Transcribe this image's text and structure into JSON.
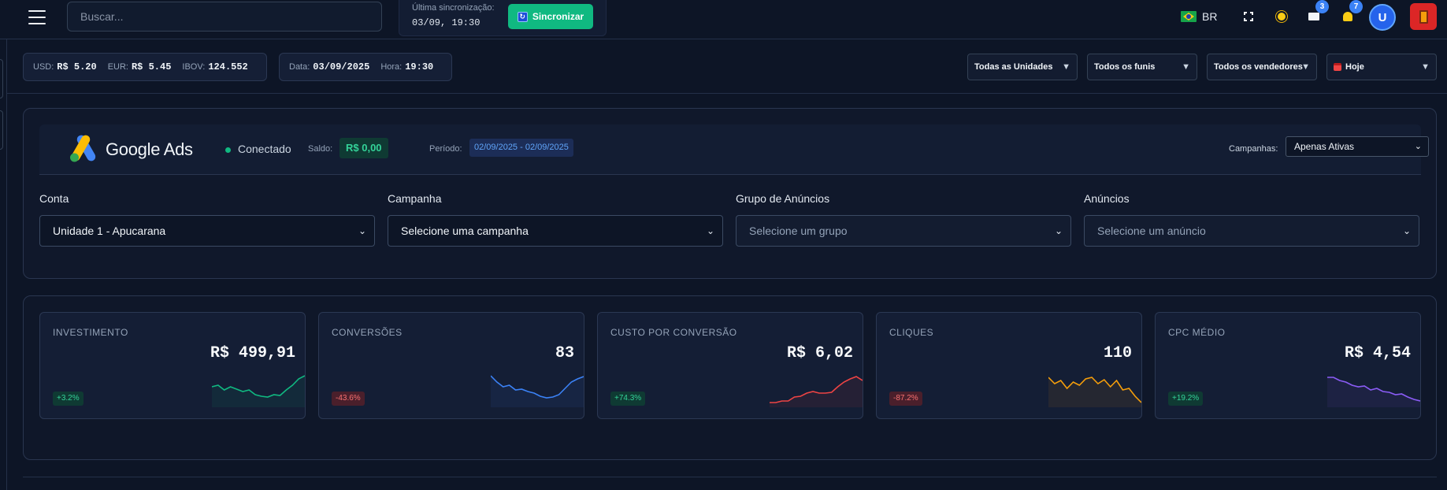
{
  "topbar": {
    "search_placeholder": "Buscar...",
    "sync_label": "Última sincronização:",
    "sync_time": "03/09, 19:30",
    "sync_button": "Sincronizar",
    "lang": "BR",
    "messages_count": "3",
    "notifications_count": "7",
    "avatar_letter": "U"
  },
  "infobar": {
    "usd_label": "USD:",
    "usd_value": "R$ 5.20",
    "eur_label": "EUR:",
    "eur_value": "R$ 5.45",
    "ibov_label": "IBOV:",
    "ibov_value": "124.552",
    "date_label": "Data:",
    "date_value": "03/09/2025",
    "time_label": "Hora:",
    "time_value": "19:30",
    "filters": [
      "Todas as Unidades",
      "Todos os funis",
      "Todos os vendedores",
      "Hoje"
    ]
  },
  "ads": {
    "title": "Google Ads",
    "status": "Conectado",
    "saldo_label": "Saldo:",
    "saldo_value": "R$ 0,00",
    "periodo_label": "Período:",
    "periodo_value": "02/09/2025 - 02/09/2025",
    "campanhas_label": "Campanhas:",
    "campanhas_value": "Apenas Ativas",
    "fields": [
      {
        "label": "Conta",
        "value": "Unidade 1 - Apucarana"
      },
      {
        "label": "Campanha",
        "value": "Selecione uma campanha"
      },
      {
        "label": "Grupo de Anúncios",
        "value": "Selecione um grupo"
      },
      {
        "label": "Anúncios",
        "value": "Selecione um anúncio"
      }
    ]
  },
  "kpis": [
    {
      "title": "INVESTIMENTO",
      "value": "R$ 499,91",
      "delta": "+3.2%",
      "trend": "pos",
      "color": "#10b981",
      "series": [
        22,
        24,
        18,
        22,
        19,
        16,
        18,
        12,
        10,
        9,
        12,
        11,
        18,
        24,
        32,
        36
      ]
    },
    {
      "title": "CONVERSÕES",
      "value": "83",
      "delta": "-43.6%",
      "trend": "neg",
      "color": "#3b82f6",
      "series": [
        36,
        28,
        22,
        24,
        18,
        19,
        16,
        14,
        10,
        8,
        9,
        12,
        20,
        28,
        32,
        35
      ]
    },
    {
      "title": "CUSTO POR CONVERSÃO",
      "value": "R$ 6,02",
      "delta": "+74.3%",
      "trend": "pos",
      "color": "#ef4444",
      "series": [
        2,
        2,
        4,
        4,
        9,
        10,
        14,
        16,
        14,
        14,
        15,
        22,
        28,
        32,
        35,
        30
      ]
    },
    {
      "title": "CLIQUES",
      "value": "110",
      "delta": "-87.2%",
      "trend": "neg",
      "color": "#f59e0b",
      "series": [
        34,
        26,
        30,
        20,
        28,
        24,
        32,
        34,
        26,
        31,
        22,
        30,
        18,
        20,
        10,
        2
      ]
    },
    {
      "title": "CPC MÉDIO",
      "value": "R$ 4,54",
      "delta": "+19.2%",
      "trend": "pos",
      "color": "#8b5cf6",
      "series": [
        34,
        34,
        30,
        28,
        24,
        22,
        23,
        18,
        20,
        16,
        15,
        12,
        13,
        9,
        6,
        4
      ]
    }
  ]
}
